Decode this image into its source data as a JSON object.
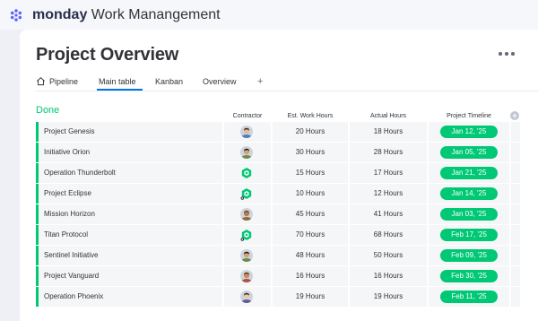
{
  "app": {
    "brand_bold": "monday",
    "brand_rest": "Work Manangement"
  },
  "page": {
    "title": "Project Overview",
    "more_icon": "more-horizontal-icon"
  },
  "tabs": [
    {
      "label": "Pipeline",
      "icon": "home-icon"
    },
    {
      "label": "Main table",
      "active": true
    },
    {
      "label": "Kanban"
    },
    {
      "label": "Overview"
    }
  ],
  "add_tab_label": "+",
  "group": {
    "title": "Done",
    "color": "#00c875"
  },
  "columns": {
    "contractor": "Contractor",
    "est_hours": "Est. Work Hours",
    "actual_hours": "Actual Hours",
    "timeline": "Project Timeline",
    "add": "+"
  },
  "rows": [
    {
      "name": "Project Genesis",
      "contractor": "person-avatar",
      "est": "20 Hours",
      "actual": "18 Hours",
      "timeline": "Jan 12, '25"
    },
    {
      "name": "Initiative Orion",
      "contractor": "person-avatar",
      "est": "30 Hours",
      "actual": "28 Hours",
      "timeline": "Jan 05, '25"
    },
    {
      "name": "Operation Thunderbolt",
      "contractor": "company-logo-avatar",
      "est": "15 Hours",
      "actual": "17 Hours",
      "timeline": "Jan 21, '25"
    },
    {
      "name": "Project Eclipse",
      "contractor": "company-logo-avatar",
      "est": "10 Hours",
      "actual": "12 Hours",
      "timeline": "Jan 14, '25"
    },
    {
      "name": "Mission Horizon",
      "contractor": "person-avatar",
      "est": "45 Hours",
      "actual": "41 Hours",
      "timeline": "Jan 03, '25"
    },
    {
      "name": "Titan Protocol",
      "contractor": "company-logo-avatar",
      "est": "70 Hours",
      "actual": "68 Hours",
      "timeline": "Feb 17, '25"
    },
    {
      "name": "Sentinel Initiative",
      "contractor": "person-avatar",
      "est": "48 Hours",
      "actual": "50 Hours",
      "timeline": "Feb 09, '25"
    },
    {
      "name": "Project Vanguard",
      "contractor": "person-avatar",
      "est": "16 Hours",
      "actual": "16 Hours",
      "timeline": "Feb 30, '25"
    },
    {
      "name": "Operation Phoenix",
      "contractor": "person-avatar",
      "est": "19 Hours",
      "actual": "19 Hours",
      "timeline": "Feb 11, '25"
    }
  ],
  "colors": {
    "status_green": "#00c875",
    "accent_blue": "#0073ea",
    "brand_purple": "#6161ff"
  }
}
